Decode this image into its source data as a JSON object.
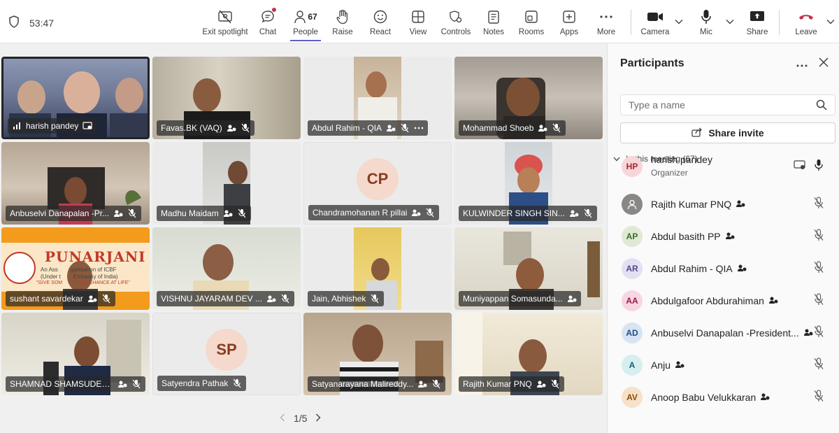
{
  "timer": "53:47",
  "toolbar": {
    "exit_spotlight": "Exit spotlight",
    "chat": "Chat",
    "people": "People",
    "people_count": "67",
    "raise": "Raise",
    "react": "React",
    "view": "View",
    "controls": "Controls",
    "notes": "Notes",
    "rooms": "Rooms",
    "apps": "Apps",
    "more": "More",
    "camera": "Camera",
    "mic": "Mic",
    "share": "Share",
    "leave": "Leave"
  },
  "tiles": [
    {
      "name": "harish pandey"
    },
    {
      "name": "Favas.BK (VAQ)"
    },
    {
      "name": "Abdul Rahim - QIA"
    },
    {
      "name": "Mohammad Shoeb"
    },
    {
      "name": "Anbuselvi Danapalan -Pr..."
    },
    {
      "name": "Madhu Maidam"
    },
    {
      "name": "Chandramohanan R pillai",
      "initials": "CP"
    },
    {
      "name": "KULWINDER SINGH SIN..."
    },
    {
      "name": "sushant savardekar",
      "banner_title": "PUNARJANI",
      "banner_line1": "An Ass        ganisation of ICBF",
      "banner_line2": "(Under t        Embassy of India)",
      "banner_line3": "\"GIVE SOM        COND CHANCE AT LIFE\""
    },
    {
      "name": "VISHNU JAYARAM DEV ..."
    },
    {
      "name": "Jain, Abhishek"
    },
    {
      "name": "Muniyappan Somasunda..."
    },
    {
      "name": "SHAMNAD SHAMSUDEE..."
    },
    {
      "name": "Satyendra Pathak",
      "initials": "SP"
    },
    {
      "name": "Satyanarayana Malireddy..."
    },
    {
      "name": "Rajith Kumar PNQ"
    }
  ],
  "pager": "1/5",
  "panel": {
    "title": "Participants",
    "search_placeholder": "Type a name",
    "share_invite": "Share invite",
    "section": "In this meeting (67)",
    "participants": [
      {
        "initials": "HP",
        "name": "harish pandey",
        "role": "Organizer",
        "avatar_bg": "#f6d6d9",
        "avatar_fg": "#a4262c"
      },
      {
        "initials": "",
        "name": "Rajith Kumar PNQ",
        "avatar_bg": "#8a8886",
        "avatar_fg": "#ffffff"
      },
      {
        "initials": "AP",
        "name": "Abdul basith PP",
        "avatar_bg": "#dfe9d6",
        "avatar_fg": "#3b6e22"
      },
      {
        "initials": "AR",
        "name": "Abdul Rahim - QIA",
        "avatar_bg": "#e3e0f3",
        "avatar_fg": "#4f4a8c"
      },
      {
        "initials": "AA",
        "name": "Abdulgafoor Abdurahiman",
        "avatar_bg": "#f6d6e2",
        "avatar_fg": "#9b1b4b"
      },
      {
        "initials": "AD",
        "name": "Anbuselvi Danapalan -President...",
        "avatar_bg": "#d6e4f3",
        "avatar_fg": "#1f4f82"
      },
      {
        "initials": "A",
        "name": "Anju",
        "avatar_bg": "#d6eef0",
        "avatar_fg": "#0e6470"
      },
      {
        "initials": "AV",
        "name": "Anoop Babu Velukkaran",
        "avatar_bg": "#f7e1c8",
        "avatar_fg": "#8a4b0e"
      }
    ]
  },
  "colors": {
    "accent": "#5b5fc7",
    "leave_red": "#c4314b",
    "spotlight_border": "#ffffff"
  }
}
